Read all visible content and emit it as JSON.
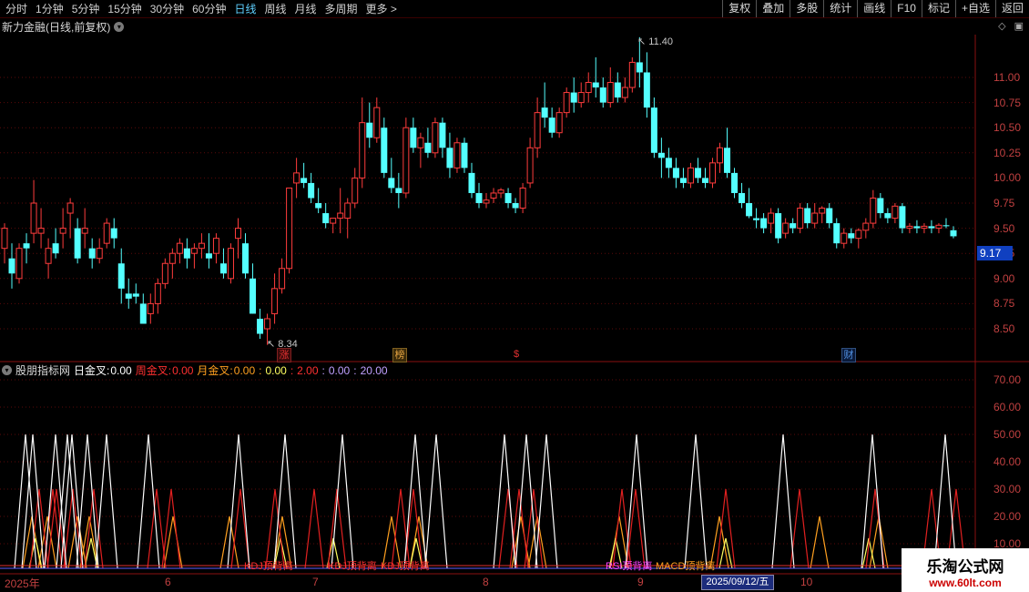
{
  "toolbar": {
    "periods": [
      "分时",
      "1分钟",
      "5分钟",
      "15分钟",
      "30分钟",
      "60分钟",
      "日线",
      "周线",
      "月线",
      "多周期",
      "更多 >"
    ],
    "active_period": "日线",
    "right_buttons": [
      "复权",
      "叠加",
      "多股",
      "统计",
      "画线",
      "F10",
      "标记",
      "+自选",
      "返回"
    ]
  },
  "main_title": "新力金融(日线,前复权)",
  "window_controls": [
    "◇",
    "▣"
  ],
  "price_axis": [
    "11.00",
    "10.75",
    "10.50",
    "10.25",
    "10.00",
    "9.75",
    "9.50",
    "9.25",
    "9.00",
    "8.75",
    "8.50"
  ],
  "last_price": "9.17",
  "high_marker": "11.40",
  "low_marker": "8.34",
  "event_markers": [
    {
      "text": "涨",
      "color": "#e03030"
    },
    {
      "text": "榜",
      "color": "#e0a040"
    },
    {
      "text": "$",
      "color": "#e03030"
    },
    {
      "text": "财",
      "color": "#5090e0"
    }
  ],
  "indicator": {
    "name": "股朋指标网",
    "label_day": "日金叉:",
    "val_day": "0.00",
    "label_week": "周金叉:",
    "val_week": "0.00",
    "label_month": "月金叉:",
    "val_month": "0.00",
    "v1": "0.00",
    "v2": "2.00",
    "v3": "0.00",
    "v4": "20.00",
    "sep": ":",
    "colors": {
      "day": "#ffffff",
      "week": "#ff3030",
      "month": "#ffa020",
      "v1": "#ffff60",
      "v2": "#ff3030",
      "v3": "#c0a0ff",
      "v4": "#c0a0ff"
    }
  },
  "indicator_axis": [
    "70.00",
    "60.00",
    "50.00",
    "40.00",
    "30.00",
    "20.00",
    "10.00"
  ],
  "signal_labels": [
    "KDJ顶背离",
    "KDJ顶背离",
    "KDJ顶背离",
    "RSI顶背离",
    "MACD顶背离"
  ],
  "date_axis": [
    "2025年",
    "6",
    "7",
    "8",
    "9",
    "10"
  ],
  "cursor_date": "2025/09/12/五",
  "watermark": {
    "line1": "乐淘公式网",
    "line2": "www.60lt.com"
  },
  "chart_data": {
    "type": "candlestick",
    "series_name": "新力金融",
    "ylim": [
      8.3,
      11.4
    ],
    "candles": [
      [
        9.3,
        9.55,
        9.15,
        9.5
      ],
      [
        9.2,
        9.35,
        8.9,
        9.05
      ],
      [
        9.0,
        9.35,
        8.95,
        9.3
      ],
      [
        9.35,
        9.45,
        9.15,
        9.3
      ],
      [
        9.45,
        9.98,
        9.35,
        9.75
      ],
      [
        9.45,
        9.7,
        9.3,
        9.5
      ],
      [
        9.15,
        9.4,
        9.0,
        9.3
      ],
      [
        9.35,
        9.5,
        9.2,
        9.25
      ],
      [
        9.45,
        9.7,
        9.3,
        9.5
      ],
      [
        9.65,
        9.8,
        9.4,
        9.75
      ],
      [
        9.5,
        9.6,
        9.15,
        9.2
      ],
      [
        9.45,
        9.7,
        9.3,
        9.5
      ],
      [
        9.3,
        9.4,
        9.1,
        9.2
      ],
      [
        9.2,
        9.4,
        9.15,
        9.3
      ],
      [
        9.35,
        9.6,
        9.3,
        9.55
      ],
      [
        9.5,
        9.6,
        9.3,
        9.4
      ],
      [
        9.15,
        9.3,
        8.75,
        8.9
      ],
      [
        8.85,
        9.0,
        8.7,
        8.8
      ],
      [
        8.85,
        8.95,
        8.75,
        8.82
      ],
      [
        8.75,
        8.85,
        8.55,
        8.55
      ],
      [
        8.65,
        8.85,
        8.55,
        8.75
      ],
      [
        8.75,
        9.0,
        8.65,
        8.95
      ],
      [
        8.95,
        9.2,
        8.9,
        9.15
      ],
      [
        9.15,
        9.3,
        9.0,
        9.25
      ],
      [
        9.25,
        9.4,
        9.15,
        9.35
      ],
      [
        9.3,
        9.4,
        9.1,
        9.2
      ],
      [
        9.25,
        9.35,
        9.1,
        9.3
      ],
      [
        9.3,
        9.45,
        9.2,
        9.35
      ],
      [
        9.25,
        9.45,
        9.1,
        9.2
      ],
      [
        9.25,
        9.45,
        9.15,
        9.4
      ],
      [
        9.15,
        9.3,
        9.0,
        9.05
      ],
      [
        9.0,
        9.35,
        8.95,
        9.3
      ],
      [
        9.4,
        9.6,
        9.2,
        9.5
      ],
      [
        9.35,
        9.45,
        9.0,
        9.05
      ],
      [
        9.0,
        9.15,
        8.65,
        8.65
      ],
      [
        8.6,
        8.7,
        8.4,
        8.45
      ],
      [
        8.5,
        8.65,
        8.34,
        8.6
      ],
      [
        8.65,
        9.05,
        8.55,
        8.9
      ],
      [
        8.9,
        9.2,
        8.85,
        9.1
      ],
      [
        9.1,
        9.9,
        9.05,
        9.9
      ],
      [
        9.95,
        10.2,
        9.8,
        10.05
      ],
      [
        10.0,
        10.15,
        9.9,
        9.95
      ],
      [
        9.95,
        10.05,
        9.75,
        9.8
      ],
      [
        9.75,
        9.9,
        9.65,
        9.7
      ],
      [
        9.65,
        9.75,
        9.5,
        9.55
      ],
      [
        9.55,
        9.6,
        9.45,
        9.6
      ],
      [
        9.6,
        9.9,
        9.45,
        9.65
      ],
      [
        9.6,
        9.8,
        9.4,
        9.75
      ],
      [
        9.75,
        10.1,
        9.7,
        10.0
      ],
      [
        10.0,
        10.8,
        9.9,
        10.55
      ],
      [
        10.55,
        10.75,
        10.3,
        10.4
      ],
      [
        10.4,
        10.8,
        10.35,
        10.7
      ],
      [
        10.5,
        10.6,
        10.0,
        10.05
      ],
      [
        10.0,
        10.2,
        9.85,
        9.9
      ],
      [
        9.9,
        10.05,
        9.7,
        9.85
      ],
      [
        9.85,
        10.6,
        9.8,
        10.5
      ],
      [
        10.5,
        10.6,
        10.25,
        10.3
      ],
      [
        10.3,
        10.45,
        10.1,
        10.4
      ],
      [
        10.35,
        10.5,
        10.2,
        10.25
      ],
      [
        10.25,
        10.6,
        10.2,
        10.55
      ],
      [
        10.55,
        10.6,
        10.2,
        10.3
      ],
      [
        10.3,
        10.45,
        10.0,
        10.1
      ],
      [
        10.1,
        10.4,
        10.05,
        10.35
      ],
      [
        10.35,
        10.4,
        10.05,
        10.1
      ],
      [
        10.05,
        10.15,
        9.8,
        9.85
      ],
      [
        9.85,
        9.95,
        9.7,
        9.75
      ],
      [
        9.75,
        9.85,
        9.7,
        9.78
      ],
      [
        9.8,
        9.9,
        9.75,
        9.85
      ],
      [
        9.85,
        9.9,
        9.8,
        9.88
      ],
      [
        9.85,
        9.9,
        9.7,
        9.75
      ],
      [
        9.75,
        9.8,
        9.65,
        9.7
      ],
      [
        9.7,
        9.95,
        9.65,
        9.9
      ],
      [
        9.95,
        10.4,
        9.9,
        10.3
      ],
      [
        10.3,
        10.8,
        10.2,
        10.65
      ],
      [
        10.7,
        10.95,
        10.5,
        10.6
      ],
      [
        10.6,
        10.7,
        10.4,
        10.45
      ],
      [
        10.45,
        10.7,
        10.4,
        10.65
      ],
      [
        10.65,
        10.9,
        10.6,
        10.85
      ],
      [
        10.85,
        11.0,
        10.65,
        10.75
      ],
      [
        10.75,
        10.95,
        10.7,
        10.85
      ],
      [
        10.85,
        11.05,
        10.75,
        10.95
      ],
      [
        10.95,
        11.2,
        10.8,
        10.9
      ],
      [
        10.9,
        11.0,
        10.7,
        10.75
      ],
      [
        10.75,
        11.1,
        10.7,
        10.95
      ],
      [
        10.95,
        11.05,
        10.75,
        10.8
      ],
      [
        10.8,
        11.0,
        10.75,
        10.9
      ],
      [
        10.9,
        11.2,
        10.85,
        11.15
      ],
      [
        11.15,
        11.4,
        10.9,
        11.05
      ],
      [
        11.05,
        11.25,
        10.6,
        10.7
      ],
      [
        10.7,
        10.8,
        10.2,
        10.25
      ],
      [
        10.25,
        10.4,
        10.0,
        10.2
      ],
      [
        10.2,
        10.3,
        10.0,
        10.1
      ],
      [
        10.1,
        10.2,
        9.9,
        10.0
      ],
      [
        10.0,
        10.1,
        9.9,
        9.95
      ],
      [
        9.95,
        10.15,
        9.9,
        10.1
      ],
      [
        10.1,
        10.2,
        9.95,
        10.0
      ],
      [
        10.0,
        10.1,
        9.9,
        9.95
      ],
      [
        9.95,
        10.2,
        9.9,
        10.15
      ],
      [
        10.15,
        10.35,
        10.05,
        10.3
      ],
      [
        10.3,
        10.5,
        10.0,
        10.05
      ],
      [
        10.05,
        10.1,
        9.8,
        9.85
      ],
      [
        9.85,
        9.95,
        9.7,
        9.75
      ],
      [
        9.75,
        9.9,
        9.6,
        9.62
      ],
      [
        9.6,
        9.7,
        9.5,
        9.58
      ],
      [
        9.6,
        9.65,
        9.45,
        9.5
      ],
      [
        9.55,
        9.7,
        9.45,
        9.65
      ],
      [
        9.65,
        9.7,
        9.35,
        9.4
      ],
      [
        9.45,
        9.6,
        9.4,
        9.55
      ],
      [
        9.55,
        9.6,
        9.45,
        9.5
      ],
      [
        9.5,
        9.75,
        9.45,
        9.7
      ],
      [
        9.7,
        9.75,
        9.5,
        9.55
      ],
      [
        9.55,
        9.75,
        9.5,
        9.65
      ],
      [
        9.65,
        9.72,
        9.55,
        9.7
      ],
      [
        9.7,
        9.75,
        9.5,
        9.55
      ],
      [
        9.55,
        9.6,
        9.3,
        9.35
      ],
      [
        9.35,
        9.5,
        9.3,
        9.45
      ],
      [
        9.45,
        9.5,
        9.35,
        9.4
      ],
      [
        9.4,
        9.5,
        9.3,
        9.48
      ],
      [
        9.48,
        9.6,
        9.4,
        9.55
      ],
      [
        9.55,
        9.88,
        9.5,
        9.8
      ],
      [
        9.8,
        9.85,
        9.6,
        9.65
      ],
      [
        9.65,
        9.7,
        9.55,
        9.6
      ],
      [
        9.6,
        9.75,
        9.55,
        9.72
      ],
      [
        9.72,
        9.75,
        9.45,
        9.5
      ],
      [
        9.5,
        9.55,
        9.45,
        9.52
      ],
      [
        9.52,
        9.58,
        9.45,
        9.5
      ],
      [
        9.5,
        9.55,
        9.45,
        9.52
      ],
      [
        9.52,
        9.58,
        9.45,
        9.5
      ],
      [
        9.5,
        9.55,
        9.45,
        9.53
      ],
      [
        9.53,
        9.6,
        9.5,
        9.52
      ],
      [
        9.48,
        9.52,
        9.4,
        9.42
      ]
    ],
    "indicator": {
      "ylim": [
        0,
        75
      ],
      "white_peaks": [
        28,
        36,
        61,
        74,
        79,
        96,
        117,
        163,
        262,
        313,
        376,
        456,
        479,
        554,
        578,
        600,
        699,
        764,
        860,
        958,
        1038
      ],
      "red_peaks": [
        43,
        58,
        62,
        80,
        103,
        172,
        188,
        264,
        302,
        345,
        370,
        440,
        454,
        558,
        570,
        586,
        683,
        698,
        797,
        878,
        961,
        1023,
        1050
      ],
      "orange_peaks": [
        35,
        52,
        85,
        98,
        190,
        252,
        310,
        430,
        460,
        572,
        590,
        680,
        790,
        900,
        965
      ],
      "yellow_peaks": [
        39,
        100,
        308,
        366,
        457,
        676,
        797,
        954
      ]
    }
  }
}
